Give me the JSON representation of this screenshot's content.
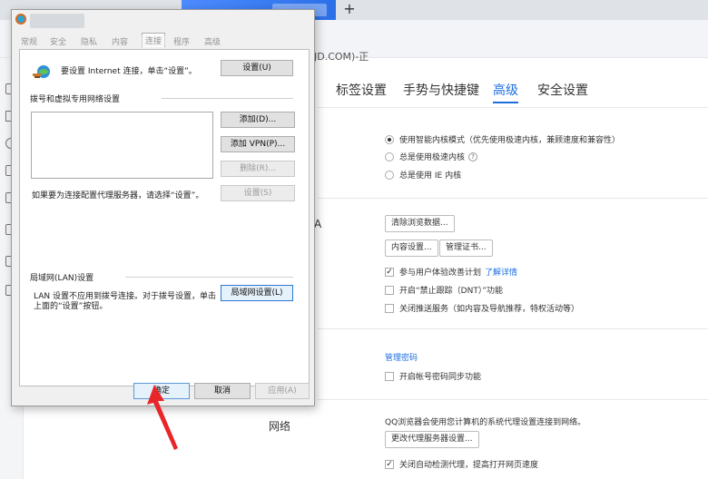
{
  "browser": {
    "new_tab": "+",
    "address_partial": "JD.COM)-正"
  },
  "settings": {
    "tabs": [
      {
        "label": "标签设置",
        "active": false
      },
      {
        "label": "手势与快捷键",
        "active": false
      },
      {
        "label": "高级",
        "active": true
      },
      {
        "label": "安全设置",
        "active": false
      }
    ],
    "kernel": {
      "options": [
        {
          "label": "使用智能内核模式（优先使用极速内核，兼顾速度和兼容性）",
          "checked": true
        },
        {
          "label": "总是使用极速内核",
          "checked": false
        },
        {
          "label": "总是使用 IE 内核",
          "checked": false
        }
      ],
      "help_glyph": "?"
    },
    "privacy": {
      "section_char": "A",
      "clear_data_button": "清除浏览数据...",
      "content_settings_button": "内容设置...",
      "manage_certs_button": "管理证书...",
      "improvement_plan": {
        "label": "参与用户体验改善计划",
        "link": "了解详情",
        "checked": true
      },
      "dnt": {
        "label": "开启“禁止跟踪（DNT）”功能",
        "checked": false
      },
      "push": {
        "label": "关闭推送服务（如内容及导航推荐，特权活动等）",
        "checked": false
      }
    },
    "password": {
      "manage_link": "管理密码",
      "sync": {
        "label": "开启帐号密码同步功能",
        "checked": false
      }
    },
    "network": {
      "title": "网络",
      "description": "QQ浏览器会使用您计算机的系统代理设置连接到网络。",
      "proxy_button": "更改代理服务器设置...",
      "auto_detect": {
        "label": "关闭自动检测代理，提高打开网页速度",
        "checked": true
      }
    },
    "check_glyph": "✓"
  },
  "dialog": {
    "tabs": [
      "常规",
      "安全",
      "隐私",
      "内容",
      "连接",
      "程序",
      "高级"
    ],
    "active_tab": "连接",
    "setup_text": "要设置 Internet 连接，单击“设置”。",
    "setup_button": "设置(U)",
    "dialup_group": "拨号和虚拟专用网络设置",
    "add_button": "添加(D)...",
    "add_vpn_button": "添加 VPN(P)...",
    "delete_button": "删除(R)...",
    "settings_button": "设置(S)",
    "proxy_hint": "如果要为连接配置代理服务器，请选择“设置”。",
    "lan_group": "局域网(LAN)设置",
    "lan_text_line1": "LAN 设置不应用到拨号连接。对于拨号设置，单击",
    "lan_text_line2": "上面的“设置”按钮。",
    "lan_button": "局域网设置(L)",
    "ok_button": "确定",
    "cancel_button": "取消",
    "apply_button": "应用(A)"
  },
  "colors": {
    "accent": "#1d6fe0",
    "annotation_arrow": "#e8262a"
  }
}
